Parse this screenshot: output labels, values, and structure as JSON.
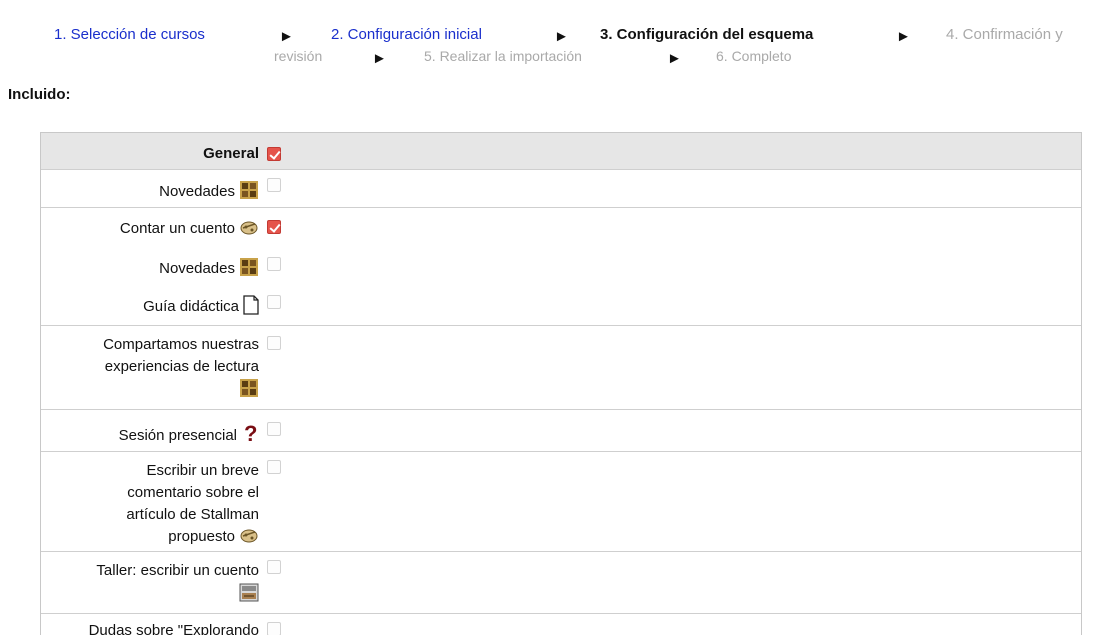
{
  "wizard": {
    "steps": [
      {
        "label": "1. Selección de cursos",
        "state": "done"
      },
      {
        "label": "2. Configuración inicial",
        "state": "done"
      },
      {
        "label": "3. Configuración del esquema",
        "state": "current"
      },
      {
        "label": "4. Confirmación y",
        "state": "pending"
      },
      {
        "label": "revisión",
        "state": "pending"
      },
      {
        "label": "5. Realizar la importación",
        "state": "pending"
      },
      {
        "label": "6. Completo",
        "state": "pending"
      }
    ],
    "arrow": "►"
  },
  "included_label": "Incluido:",
  "items": [
    {
      "label": "General",
      "icon": null,
      "checked": true,
      "section": true
    },
    {
      "label": "Novedades",
      "icon": "forum-icon",
      "checked": false
    },
    {
      "label": "Contar un cuento",
      "icon": "workshop-icon",
      "checked": true
    },
    {
      "label": "Novedades",
      "icon": "forum-icon",
      "checked": false
    },
    {
      "label": "Guía didáctica",
      "icon": "file-icon",
      "checked": false
    },
    {
      "label": "Compartamos nuestras experiencias de lectura",
      "icon": "forum-icon",
      "checked": false
    },
    {
      "label": "Sesión presencial",
      "icon": "question-icon",
      "checked": false
    },
    {
      "label": "Escribir un breve comentario sobre el artículo de Stallman propuesto",
      "icon": "workshop-icon",
      "checked": false
    },
    {
      "label": "Taller: escribir un cuento",
      "icon": "assignment-icon",
      "checked": false
    },
    {
      "label": "Dudas sobre \"Explorando",
      "icon": null,
      "checked": false
    }
  ],
  "colors": {
    "link": "#1a2fcc",
    "pending": "#a9a9a9",
    "checked": "#e5544b",
    "section_bg": "#e6e6e6"
  }
}
